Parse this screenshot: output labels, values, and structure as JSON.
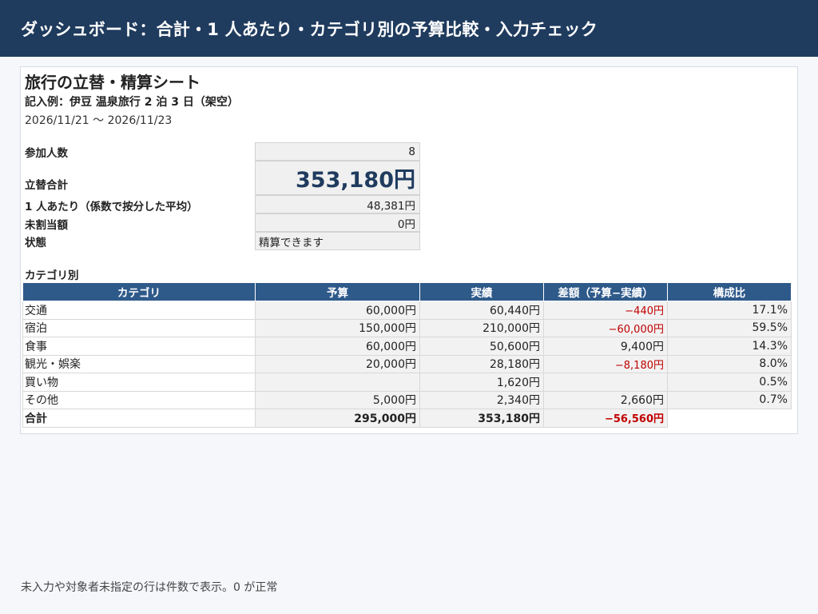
{
  "header": {
    "title": "ダッシュボード：合計・1 人あたり・カテゴリ別の予算比較・入力チェック"
  },
  "sheet": {
    "title": "旅行の立替・精算シート",
    "subtitle": "記入例：伊豆 温泉旅行 2 泊 3 日（架空）",
    "date_range": "2026/11/21 〜 2026/11/23"
  },
  "summary": {
    "participants_label": "参加人数",
    "participants_value": "8",
    "total_label": "立替合計",
    "total_value": "353,180円",
    "per_person_label": "1 人あたり（係数で按分した平均）",
    "per_person_value": "48,381円",
    "unallocated_label": "未割当額",
    "unallocated_value": "0円",
    "status_label": "状態",
    "status_value": "精算できます"
  },
  "category": {
    "section_label": "カテゴリ別",
    "headers": [
      "カテゴリ",
      "予算",
      "実績",
      "差額（予算−実績）",
      "構成比"
    ],
    "rows": [
      {
        "name": "交通",
        "budget": "60,000円",
        "actual": "60,440円",
        "diff": "−440円",
        "diff_negative": true,
        "ratio": "17.1%"
      },
      {
        "name": "宿泊",
        "budget": "150,000円",
        "actual": "210,000円",
        "diff": "−60,000円",
        "diff_negative": true,
        "ratio": "59.5%"
      },
      {
        "name": "食事",
        "budget": "60,000円",
        "actual": "50,600円",
        "diff": "9,400円",
        "diff_negative": false,
        "ratio": "14.3%"
      },
      {
        "name": "観光・娯楽",
        "budget": "20,000円",
        "actual": "28,180円",
        "diff": "−8,180円",
        "diff_negative": true,
        "ratio": "8.0%"
      },
      {
        "name": "買い物",
        "budget": "",
        "actual": "1,620円",
        "diff": "",
        "diff_negative": false,
        "ratio": "0.5%"
      },
      {
        "name": "その他",
        "budget": "5,000円",
        "actual": "2,340円",
        "diff": "2,660円",
        "diff_negative": false,
        "ratio": "0.7%"
      }
    ],
    "total": {
      "name": "合計",
      "budget": "295,000円",
      "actual": "353,180円",
      "diff": "−56,560円"
    }
  },
  "footer": {
    "note": "未入力や対象者未指定の行は件数で表示。0 が正常"
  },
  "colors": {
    "header_bg": "#1f3b5e",
    "table_header_bg": "#2e5a8a",
    "negative": "#c00000"
  }
}
